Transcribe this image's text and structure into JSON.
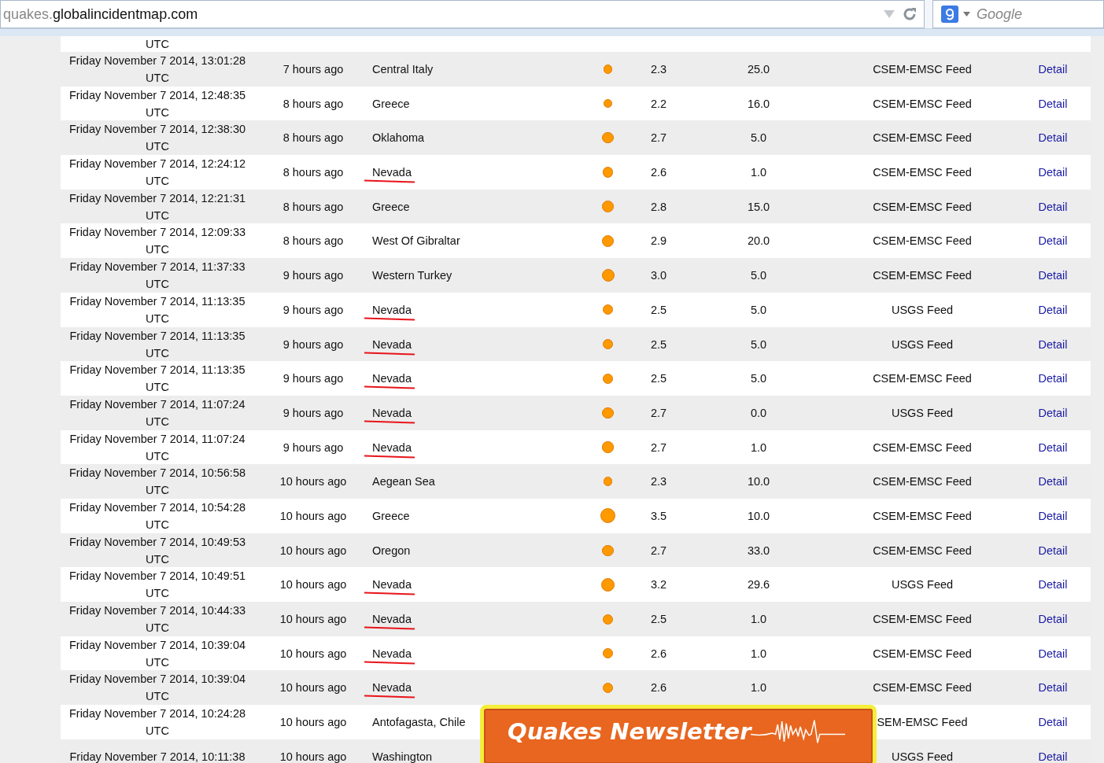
{
  "address_bar": {
    "subdomain": "quakes.",
    "domain": "globalincidentmap.com"
  },
  "search": {
    "placeholder": "Google"
  },
  "top_row_fragment": {
    "date": "UTC"
  },
  "rows": [
    {
      "date": "Friday November 7 2014, 13:01:28 UTC",
      "ago": "7 hours ago",
      "location": "Central Italy",
      "marked": false,
      "magnitude": "2.3",
      "depth": "25.0",
      "source": "CSEM-EMSC Feed",
      "link": "Detail"
    },
    {
      "date": "Friday November 7 2014, 12:48:35 UTC",
      "ago": "8 hours ago",
      "location": "Greece",
      "marked": false,
      "magnitude": "2.2",
      "depth": "16.0",
      "source": "CSEM-EMSC Feed",
      "link": "Detail"
    },
    {
      "date": "Friday November 7 2014, 12:38:30 UTC",
      "ago": "8 hours ago",
      "location": "Oklahoma",
      "marked": false,
      "magnitude": "2.7",
      "depth": "5.0",
      "source": "CSEM-EMSC Feed",
      "link": "Detail"
    },
    {
      "date": "Friday November 7 2014, 12:24:12 UTC",
      "ago": "8 hours ago",
      "location": "Nevada",
      "marked": true,
      "magnitude": "2.6",
      "depth": "1.0",
      "source": "CSEM-EMSC Feed",
      "link": "Detail"
    },
    {
      "date": "Friday November 7 2014, 12:21:31 UTC",
      "ago": "8 hours ago",
      "location": "Greece",
      "marked": false,
      "magnitude": "2.8",
      "depth": "15.0",
      "source": "CSEM-EMSC Feed",
      "link": "Detail"
    },
    {
      "date": "Friday November 7 2014, 12:09:33 UTC",
      "ago": "8 hours ago",
      "location": "West Of Gibraltar",
      "marked": false,
      "magnitude": "2.9",
      "depth": "20.0",
      "source": "CSEM-EMSC Feed",
      "link": "Detail"
    },
    {
      "date": "Friday November 7 2014, 11:37:33 UTC",
      "ago": "9 hours ago",
      "location": "Western Turkey",
      "marked": false,
      "magnitude": "3.0",
      "depth": "5.0",
      "source": "CSEM-EMSC Feed",
      "link": "Detail"
    },
    {
      "date": "Friday November 7 2014, 11:13:35 UTC",
      "ago": "9 hours ago",
      "location": "Nevada",
      "marked": true,
      "magnitude": "2.5",
      "depth": "5.0",
      "source": "USGS Feed",
      "link": "Detail"
    },
    {
      "date": "Friday November 7 2014, 11:13:35 UTC",
      "ago": "9 hours ago",
      "location": "Nevada",
      "marked": true,
      "magnitude": "2.5",
      "depth": "5.0",
      "source": "USGS Feed",
      "link": "Detail"
    },
    {
      "date": "Friday November 7 2014, 11:13:35 UTC",
      "ago": "9 hours ago",
      "location": "Nevada",
      "marked": true,
      "magnitude": "2.5",
      "depth": "5.0",
      "source": "CSEM-EMSC Feed",
      "link": "Detail"
    },
    {
      "date": "Friday November 7 2014, 11:07:24 UTC",
      "ago": "9 hours ago",
      "location": "Nevada",
      "marked": true,
      "magnitude": "2.7",
      "depth": "0.0",
      "source": "USGS Feed",
      "link": "Detail"
    },
    {
      "date": "Friday November 7 2014, 11:07:24 UTC",
      "ago": "9 hours ago",
      "location": "Nevada",
      "marked": true,
      "magnitude": "2.7",
      "depth": "1.0",
      "source": "CSEM-EMSC Feed",
      "link": "Detail"
    },
    {
      "date": "Friday November 7 2014, 10:56:58 UTC",
      "ago": "10 hours ago",
      "location": "Aegean Sea",
      "marked": false,
      "magnitude": "2.3",
      "depth": "10.0",
      "source": "CSEM-EMSC Feed",
      "link": "Detail"
    },
    {
      "date": "Friday November 7 2014, 10:54:28 UTC",
      "ago": "10 hours ago",
      "location": "Greece",
      "marked": false,
      "magnitude": "3.5",
      "depth": "10.0",
      "source": "CSEM-EMSC Feed",
      "link": "Detail"
    },
    {
      "date": "Friday November 7 2014, 10:49:53 UTC",
      "ago": "10 hours ago",
      "location": "Oregon",
      "marked": false,
      "magnitude": "2.7",
      "depth": "33.0",
      "source": "CSEM-EMSC Feed",
      "link": "Detail"
    },
    {
      "date": "Friday November 7 2014, 10:49:51 UTC",
      "ago": "10 hours ago",
      "location": "Nevada",
      "marked": true,
      "magnitude": "3.2",
      "depth": "29.6",
      "source": "USGS Feed",
      "link": "Detail"
    },
    {
      "date": "Friday November 7 2014, 10:44:33 UTC",
      "ago": "10 hours ago",
      "location": "Nevada",
      "marked": true,
      "magnitude": "2.5",
      "depth": "1.0",
      "source": "CSEM-EMSC Feed",
      "link": "Detail"
    },
    {
      "date": "Friday November 7 2014, 10:39:04 UTC",
      "ago": "10 hours ago",
      "location": "Nevada",
      "marked": true,
      "magnitude": "2.6",
      "depth": "1.0",
      "source": "CSEM-EMSC Feed",
      "link": "Detail"
    },
    {
      "date": "Friday November 7 2014, 10:39:04 UTC",
      "ago": "10 hours ago",
      "location": "Nevada",
      "marked": true,
      "magnitude": "2.6",
      "depth": "1.0",
      "source": "CSEM-EMSC Feed",
      "link": "Detail"
    },
    {
      "date": "Friday November 7 2014, 10:24:28 UTC",
      "ago": "10 hours ago",
      "location": "Antofagasta, Chile",
      "marked": false,
      "source": "SEM-EMSC Feed",
      "link": "Detail"
    },
    {
      "date": "Friday November 7 2014, 10:11:38",
      "ago": "10 hours ago",
      "location": "Washington",
      "marked": false,
      "source": "USGS Feed",
      "link": "Detail"
    }
  ],
  "newsletter_banner": {
    "title": "Quakes Newsletter"
  }
}
